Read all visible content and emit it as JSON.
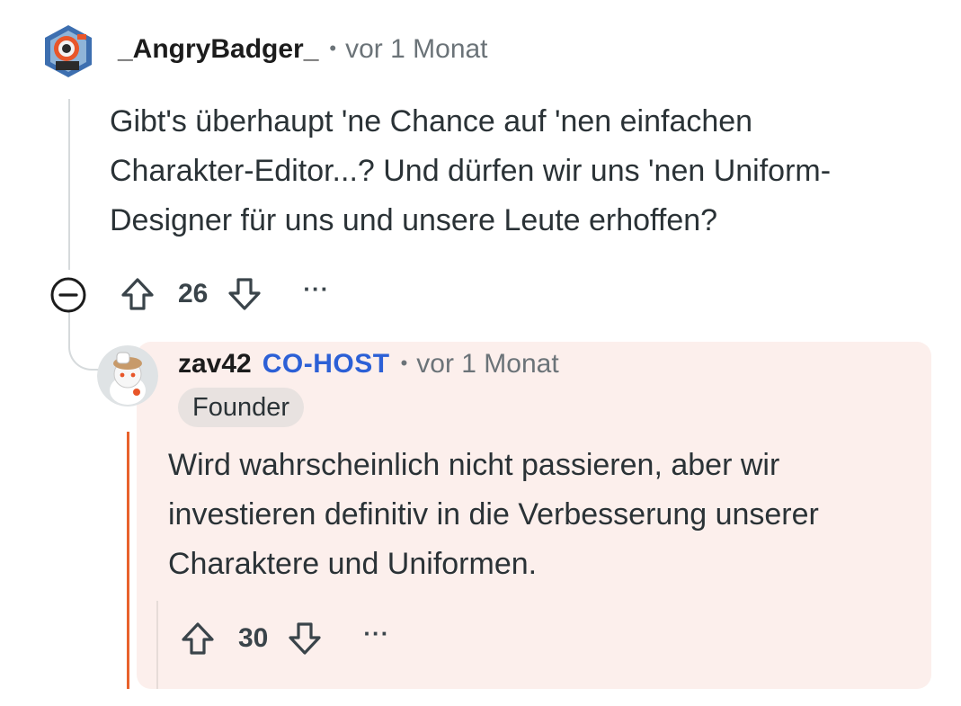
{
  "comment": {
    "username": "_AngryBadger_",
    "separator": "•",
    "time": "vor 1 Monat",
    "body_lines": [
      "Gibt's überhaupt 'ne Chance auf 'nen einfachen",
      "Charakter-Editor...? Und dürfen wir uns 'nen Uniform-",
      "Designer für uns und unsere Leute erhoffen?"
    ],
    "score": "26",
    "more_label": "···",
    "icons": {
      "collapse": "minus-circle-icon",
      "upvote": "arrow-up-icon",
      "downvote": "arrow-down-icon",
      "more": "ellipsis-icon"
    }
  },
  "reply": {
    "username": "zav42",
    "role_badge": "CO-HOST",
    "separator": "•",
    "time": "vor 1 Monat",
    "flair": "Founder",
    "body_lines": [
      "Wird wahrscheinlich nicht passieren, aber wir",
      "investieren definitiv in die Verbesserung unserer",
      "Charaktere und Uniformen."
    ],
    "score": "30",
    "more_label": "···",
    "highlight_color": "#fcefec",
    "accent_color": "#e8622c",
    "badge_color": "#2c60d6"
  }
}
